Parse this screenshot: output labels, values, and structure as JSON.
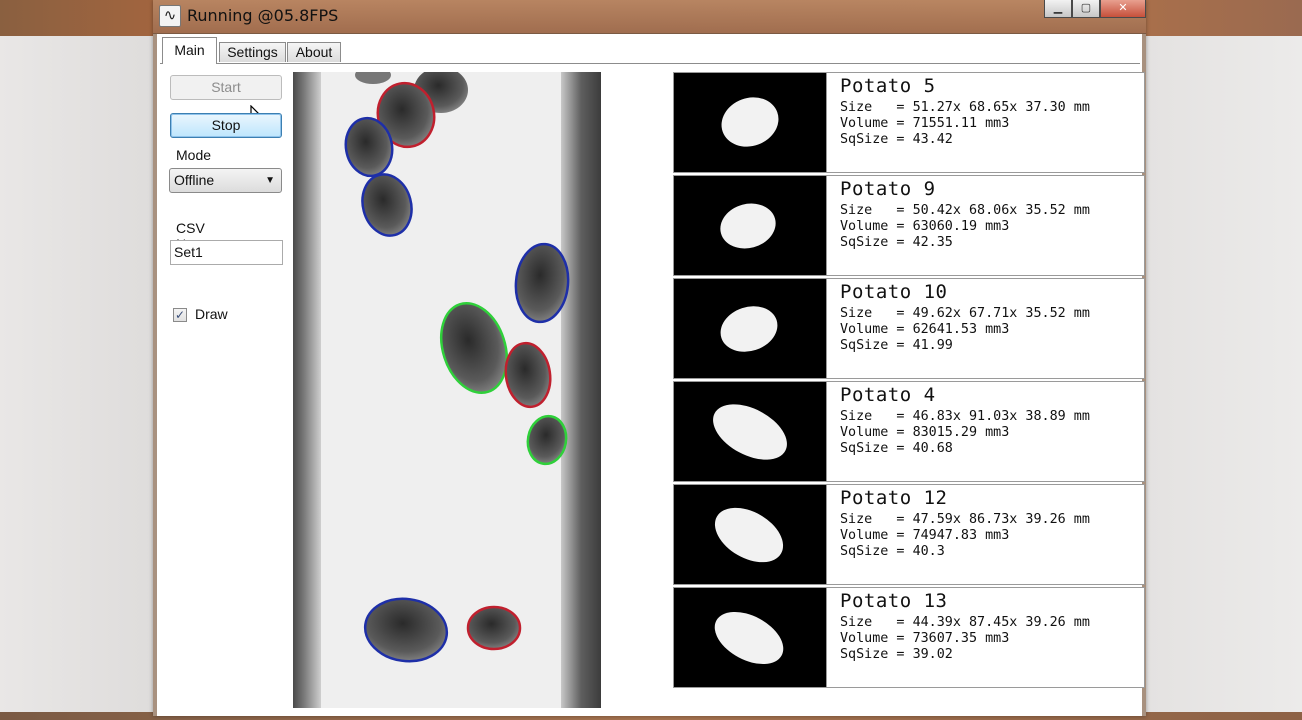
{
  "window": {
    "title": "Running @05.8FPS",
    "app_icon": "wave-icon",
    "buttons": [
      "minimize-icon",
      "maximize-icon",
      "close-icon"
    ]
  },
  "tabs": [
    {
      "label": "Main",
      "active": true
    },
    {
      "label": "Settings",
      "active": false
    },
    {
      "label": "About",
      "active": false
    }
  ],
  "controls": {
    "start_label": "Start",
    "start_enabled": false,
    "stop_label": "Stop",
    "mode_label": "Mode",
    "mode_value": "Offline",
    "csv_label": "CSV Name",
    "csv_value": "Set1",
    "draw_label": "Draw",
    "draw_checked": true
  },
  "detection_colors": {
    "red": "#c0202e",
    "blue": "#1e2fa8",
    "green": "#2fd03a"
  },
  "potatoes": [
    {
      "name": "Potato 5",
      "size": "51.27x 68.65x 37.30 mm",
      "volume": "71551.11 mm3",
      "sqsize": "43.42"
    },
    {
      "name": "Potato 9",
      "size": "50.42x 68.06x 35.52 mm",
      "volume": "63060.19 mm3",
      "sqsize": "42.35"
    },
    {
      "name": "Potato 10",
      "size": "49.62x 67.71x 35.52 mm",
      "volume": "62641.53 mm3",
      "sqsize": "41.99"
    },
    {
      "name": "Potato 4",
      "size": "46.83x 91.03x 38.89 mm",
      "volume": "83015.29 mm3",
      "sqsize": "40.68"
    },
    {
      "name": "Potato 12",
      "size": "47.59x 86.73x 39.26 mm",
      "volume": "74947.83 mm3",
      "sqsize": "40.3"
    },
    {
      "name": "Potato 13",
      "size": "44.39x 87.45x 39.26 mm",
      "volume": "73607.35 mm3",
      "sqsize": "39.02"
    }
  ],
  "stat_labels": {
    "size": "Size   = ",
    "volume": "Volume = ",
    "sqsize": "SqSize = "
  }
}
